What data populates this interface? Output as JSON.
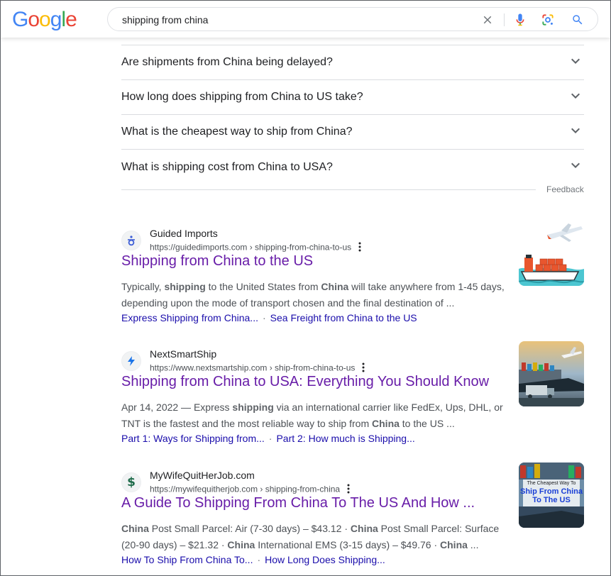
{
  "header": {
    "logo_letters": [
      {
        "ch": "G",
        "color": "#4285F4"
      },
      {
        "ch": "o",
        "color": "#EA4335"
      },
      {
        "ch": "o",
        "color": "#FBBC05"
      },
      {
        "ch": "g",
        "color": "#4285F4"
      },
      {
        "ch": "l",
        "color": "#34A853"
      },
      {
        "ch": "e",
        "color": "#EA4335"
      }
    ],
    "search_query": "shipping from china",
    "icons": [
      "clear-icon",
      "microphone-icon",
      "lens-icon",
      "search-icon"
    ]
  },
  "paa": {
    "questions": [
      "Are shipments from China being delayed?",
      "How long does shipping from China to US take?",
      "What is the cheapest way to ship from China?",
      "What is shipping cost from China to USA?"
    ],
    "feedback_label": "Feedback"
  },
  "results": [
    {
      "site_name": "Guided Imports",
      "url": "https://guidedimports.com › shipping-from-china-to-us",
      "title": "Shipping from China to the US",
      "snippet_html": "Typically, <b>shipping</b> to the United States from <b>China</b> will take anywhere from 1-45 days, depending upon the mode of transport chosen and the final destination of ...",
      "sublinks": [
        "Express Shipping from China...",
        "Sea Freight from China to the US"
      ],
      "icon": "guided-imports-logo-icon",
      "thumb_alt": "ship-and-plane-illustration"
    },
    {
      "site_name": "NextSmartShip",
      "url": "https://www.nextsmartship.com › ship-from-china-to-us",
      "title": "Shipping from China to USA: Everything You Should Know",
      "snippet_html": "Apr 14, 2022 — Express <b>shipping</b> via an international carrier like FedEx, Ups, DHL, or TNT is the fastest and the most reliable way to ship from <b>China</b> to the US ...",
      "sublinks": [
        "Part 1: Ways for Shipping from...",
        "Part 2: How much is Shipping..."
      ],
      "icon": "nextsmartship-logo-icon",
      "thumb_alt": "cargo-ship-truck-plane-photo"
    },
    {
      "site_name": "MyWifeQuitHerJob.com",
      "url": "https://mywifequitherjob.com › shipping-from-china",
      "title": "A Guide To Shipping From China To The US And How ...",
      "snippet_html": "<b>China</b> Post Small Parcel: Air (7-30 days) – $43.12 · <b>China</b> Post Small Parcel: Surface (20-90 days) – $21.32 · <b>China</b> International EMS (3-15 days) – $49.76 · <b>China</b> ...",
      "sublinks": [
        "How To Ship From China To...",
        "How Long Does Shipping..."
      ],
      "icon": "dollar-sign-logo-icon",
      "thumb_alt": "cheapest-way-to-ship-from-china-thumbnail",
      "thumb_text_top": "The Cheapest Way To",
      "thumb_text_main": "Ship From China To The US"
    }
  ],
  "colors": {
    "visited_title": "#681da8",
    "link": "#1a0dab",
    "snippet": "#4d5156"
  }
}
